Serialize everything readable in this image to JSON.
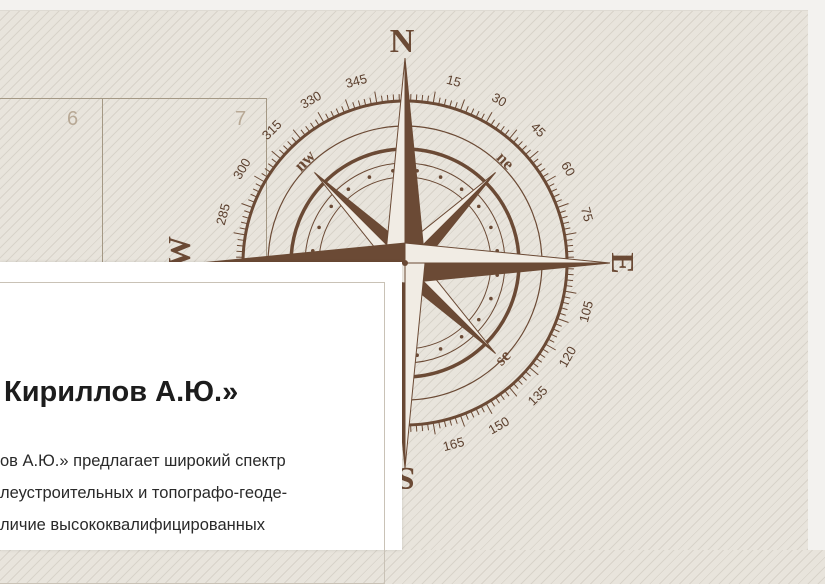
{
  "grid": {
    "cells": [
      "6",
      "7"
    ]
  },
  "compass": {
    "cardinals": {
      "north": "N",
      "east": "E",
      "south": "S",
      "west": "W"
    },
    "intercardinals": {
      "nw": "nw",
      "ne": "ne",
      "se": "se"
    },
    "degrees": [
      "15",
      "30",
      "45",
      "60",
      "75",
      "105",
      "120",
      "135",
      "150",
      "165",
      "285",
      "300",
      "315",
      "330",
      "345"
    ]
  },
  "panel": {
    "title": "Кириллов А.Ю.»",
    "lines": [
      "ов А.Ю.» предлагает широкий спектр",
      "леустроительных и топографо-геоде-",
      "личие высококвалифицированных"
    ]
  },
  "colors": {
    "compass": "#6b4a35",
    "background": "#e8e4dc",
    "grid": "#a49884"
  }
}
